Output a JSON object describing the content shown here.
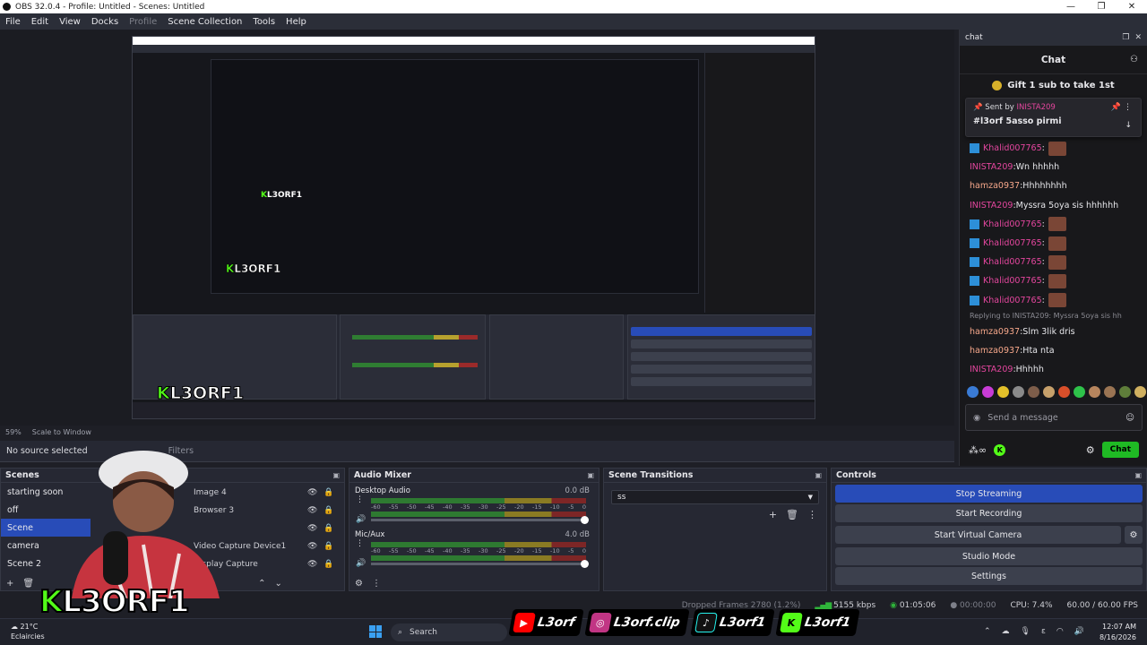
{
  "window": {
    "title": "OBS 32.0.4 - Profile: Untitled - Scenes: Untitled"
  },
  "menu": [
    "File",
    "Edit",
    "View",
    "Docks",
    "Profile",
    "Scene Collection",
    "Tools",
    "Help"
  ],
  "preview": {
    "zoom": "59%",
    "scale_mode": "Scale to Window",
    "source_status": "No source selected",
    "filters_label": "Filters"
  },
  "chat": {
    "dock_title": "chat",
    "header": "Chat",
    "gift_banner": "Gift 1 sub to take 1st",
    "pinned": {
      "sent_by_label": "Sent by",
      "sent_by_user": "INISTA209",
      "message": "#l3orf 5asso pirmi"
    },
    "messages": [
      {
        "user": "Khalid007765",
        "text": "",
        "color": "#e4469e",
        "emote": true,
        "badge": true
      },
      {
        "user": "INISTA209",
        "text": "Wn hhhhh",
        "color": "#e4469e",
        "emote": false,
        "badge": false
      },
      {
        "user": "hamza0937",
        "text": "Hhhhhhhh",
        "color": "#f7a88b",
        "emote": false,
        "badge": false
      },
      {
        "user": "INISTA209",
        "text": "Myssra 5oya sis hhhhhh",
        "color": "#e4469e",
        "emote": false,
        "badge": false
      },
      {
        "user": "Khalid007765",
        "text": "",
        "color": "#e4469e",
        "emote": true,
        "badge": true
      },
      {
        "user": "Khalid007765",
        "text": "",
        "color": "#e4469e",
        "emote": true,
        "badge": true
      },
      {
        "user": "Khalid007765",
        "text": "",
        "color": "#e4469e",
        "emote": true,
        "badge": true
      },
      {
        "user": "Khalid007765",
        "text": "",
        "color": "#e4469e",
        "emote": true,
        "badge": true
      },
      {
        "user": "Khalid007765",
        "text": "",
        "color": "#e4469e",
        "emote": true,
        "badge": true
      }
    ],
    "reply_note": "Replying to INISTA209: Myssra 5oya sis hh",
    "messages_after": [
      {
        "user": "hamza0937",
        "text": "Slm 3lik dris",
        "color": "#f7a88b"
      },
      {
        "user": "hamza0937",
        "text": "Hta nta",
        "color": "#f7a88b"
      },
      {
        "user": "INISTA209",
        "text": "Hhhhh",
        "color": "#e4469e"
      }
    ],
    "send_placeholder": "Send a message",
    "chat_button": "Chat"
  },
  "scenes": {
    "title": "Scenes",
    "items": [
      "starting soon",
      "off",
      "Scene",
      "camera",
      "Scene 2"
    ],
    "selected": "Scene",
    "sources": [
      "Image 4",
      "Browser 3",
      "",
      "Video Capture Device1",
      "Display Capture"
    ]
  },
  "mixer": {
    "title": "Audio Mixer",
    "channels": [
      {
        "name": "Desktop Audio",
        "level": "0.0 dB"
      },
      {
        "name": "Mic/Aux",
        "level": "4.0 dB"
      }
    ],
    "ticks": [
      "-60",
      "-55",
      "-50",
      "-45",
      "-40",
      "-35",
      "-30",
      "-25",
      "-20",
      "-15",
      "-10",
      "-5",
      "0"
    ]
  },
  "transitions": {
    "title": "Scene Transitions",
    "selected": "ss"
  },
  "controls": {
    "title": "Controls",
    "stop_streaming": "Stop Streaming",
    "start_recording": "Start Recording",
    "start_virtual_camera": "Start Virtual Camera",
    "studio_mode": "Studio Mode",
    "settings": "Settings"
  },
  "stats": {
    "dropped_frames": "Dropped Frames 2780 (1.2%)",
    "bitrate": "5155 kbps",
    "stream_time": "01:05:06",
    "record_time": "00:00:00",
    "cpu": "CPU: 7.4%",
    "fps": "60.00 / 60.00 FPS"
  },
  "taskbar": {
    "temp": "21°C",
    "weather": "Eclaircies",
    "search": "Search",
    "time": "12:07 AM",
    "date": "8/16/2026"
  },
  "overlay": {
    "socials": [
      {
        "platform": "youtube-icon",
        "handle": "L3orf",
        "color": "#ff0000"
      },
      {
        "platform": "instagram-icon",
        "handle": "L3orf.clip",
        "color": "#c13584"
      },
      {
        "platform": "tiktok-icon",
        "handle": "L3orf1",
        "color": "#111111"
      },
      {
        "platform": "kick-icon",
        "handle": "L3orf1",
        "color": "#53fc18"
      }
    ],
    "logo": {
      "k": "K",
      "text": "L3ORF1"
    }
  }
}
